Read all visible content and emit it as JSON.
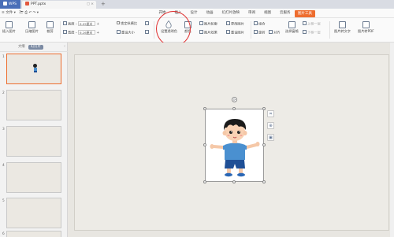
{
  "titlebar": {
    "app_name": "WPS",
    "doc_name": "PPT.pptx",
    "tab_actions": "◻ ×",
    "new_tab": "+"
  },
  "menubar": {
    "file_menu": "≡ 文件 ▾",
    "quick_tools": "🗁 ⎙ ↶ ↷ ▾",
    "tabs": [
      "开始",
      "插入",
      "设计",
      "动画",
      "幻灯片放映",
      "审阅",
      "视图",
      "云服务",
      "图片工具"
    ],
    "active_tab": "图片工具"
  },
  "ribbon": {
    "insert_picture": "插入图片",
    "compress_picture": "压缩图片",
    "crop": "裁剪",
    "height_label": "高度",
    "width_label": "宽度",
    "height_value": "8.05厘米",
    "width_value": "6.26厘米",
    "lock_ratio": "锁定纵横比",
    "reset_size": "重设大小",
    "set_transparent": "设置透明色",
    "color": "颜色",
    "picture_outline": "图片轮廓",
    "picture_effect": "图片效果",
    "change_picture": "更改图片",
    "reset_picture": "重设图片",
    "combine": "组合",
    "rotate": "旋转",
    "align": "对齐",
    "selection_pane": "选择窗格",
    "bring_forward": "上移一层",
    "send_backward": "下移一层",
    "picture_to_text": "图片转文字",
    "picture_translate": "图片转PDF"
  },
  "leftpanel": {
    "tab_outline": "大纲",
    "tab_slides": "幻灯片",
    "slide_numbers": [
      "1",
      "2",
      "3",
      "4",
      "5",
      "6"
    ]
  },
  "canvas": {
    "side_tools": [
      "crop-tool",
      "zoom-tool",
      "picture-tool"
    ]
  },
  "colors": {
    "accent": "#ee6d2f",
    "annotation": "#e03131",
    "boy_shirt": "#4a90d0",
    "boy_shorts": "#1f4f96"
  }
}
